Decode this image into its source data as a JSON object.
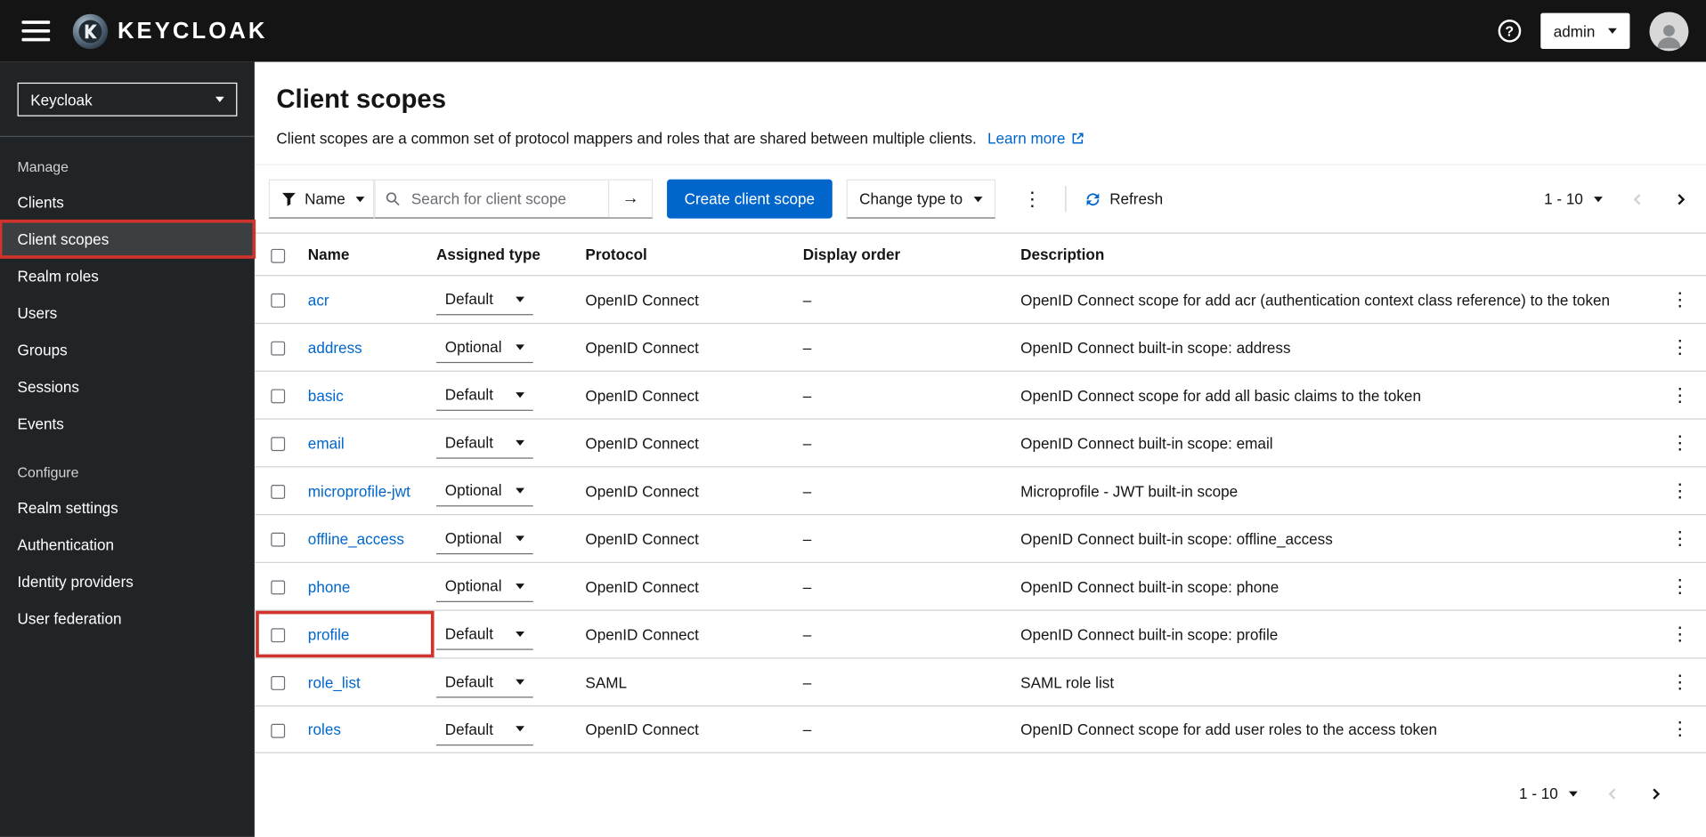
{
  "header": {
    "brand": "KEYCLOAK",
    "user": "admin"
  },
  "sidebar": {
    "realm": "Keycloak",
    "sections": [
      {
        "heading": "Manage",
        "items": [
          {
            "label": "Clients"
          },
          {
            "label": "Client scopes",
            "active": true,
            "annotated": true
          },
          {
            "label": "Realm roles"
          },
          {
            "label": "Users"
          },
          {
            "label": "Groups"
          },
          {
            "label": "Sessions"
          },
          {
            "label": "Events"
          }
        ]
      },
      {
        "heading": "Configure",
        "items": [
          {
            "label": "Realm settings"
          },
          {
            "label": "Authentication"
          },
          {
            "label": "Identity providers"
          },
          {
            "label": "User federation"
          }
        ]
      }
    ]
  },
  "page": {
    "title": "Client scopes",
    "description": "Client scopes are a common set of protocol mappers and roles that are shared between multiple clients.",
    "learn_more": "Learn more"
  },
  "toolbar": {
    "filter_label": "Name",
    "search_placeholder": "Search for client scope",
    "create_button": "Create client scope",
    "change_type": "Change type to",
    "refresh_label": "Refresh",
    "pagination_range": "1 - 10"
  },
  "footer": {
    "pagination_range": "1 - 10"
  },
  "table": {
    "columns": [
      "Name",
      "Assigned type",
      "Protocol",
      "Display order",
      "Description"
    ],
    "rows": [
      {
        "name": "acr",
        "assigned_type": "Default",
        "protocol": "OpenID Connect",
        "display_order": "–",
        "description": "OpenID Connect scope for add acr (authentication context class reference) to the token"
      },
      {
        "name": "address",
        "assigned_type": "Optional",
        "protocol": "OpenID Connect",
        "display_order": "–",
        "description": "OpenID Connect built-in scope: address"
      },
      {
        "name": "basic",
        "assigned_type": "Default",
        "protocol": "OpenID Connect",
        "display_order": "–",
        "description": "OpenID Connect scope for add all basic claims to the token"
      },
      {
        "name": "email",
        "assigned_type": "Default",
        "protocol": "OpenID Connect",
        "display_order": "–",
        "description": "OpenID Connect built-in scope: email"
      },
      {
        "name": "microprofile-jwt",
        "assigned_type": "Optional",
        "protocol": "OpenID Connect",
        "display_order": "–",
        "description": "Microprofile - JWT built-in scope"
      },
      {
        "name": "offline_access",
        "assigned_type": "Optional",
        "protocol": "OpenID Connect",
        "display_order": "–",
        "description": "OpenID Connect built-in scope: offline_access"
      },
      {
        "name": "phone",
        "assigned_type": "Optional",
        "protocol": "OpenID Connect",
        "display_order": "–",
        "description": "OpenID Connect built-in scope: phone"
      },
      {
        "name": "profile",
        "assigned_type": "Default",
        "protocol": "OpenID Connect",
        "display_order": "–",
        "description": "OpenID Connect built-in scope: profile",
        "annotated": true
      },
      {
        "name": "role_list",
        "assigned_type": "Default",
        "protocol": "SAML",
        "display_order": "–",
        "description": "SAML role list"
      },
      {
        "name": "roles",
        "assigned_type": "Default",
        "protocol": "OpenID Connect",
        "display_order": "–",
        "description": "OpenID Connect scope for add user roles to the access token"
      }
    ]
  },
  "icons": {
    "kebab": "⋮",
    "search_submit": "→",
    "help": "?"
  },
  "colors": {
    "primary": "#0066cc",
    "link": "#0066cc",
    "annotation": "#d0342c",
    "masthead": "#141414",
    "sidebar-bg": "#212427"
  }
}
